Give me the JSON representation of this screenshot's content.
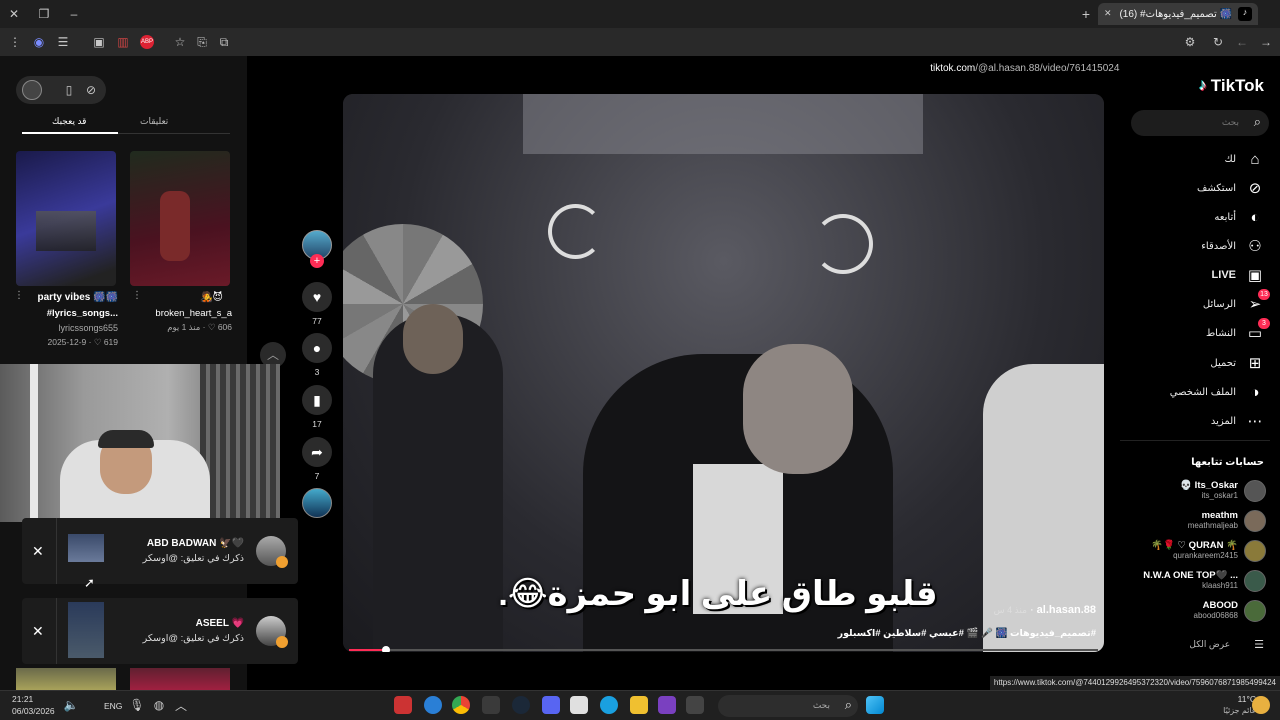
{
  "browser": {
    "tab_title": "(16) #تصميم_فيديوهات 🎆",
    "url_domain": "tiktok.com",
    "url_path": "/@al.hasan.88/video/7614150245340974357",
    "status_url": "https://www.tiktok.com/@7440129926495372320/video/7596076871985499424"
  },
  "tiktok": {
    "logo": "TikTok",
    "search_placeholder": "بحث",
    "nav": [
      {
        "label": "لك",
        "icon": "home-icon"
      },
      {
        "label": "استكشف",
        "icon": "compass-icon"
      },
      {
        "label": "أتابعه",
        "icon": "following-avatar-icon"
      },
      {
        "label": "الأصدقاء",
        "icon": "friends-icon"
      },
      {
        "label": "LIVE",
        "icon": "live-icon"
      },
      {
        "label": "الرسائل",
        "icon": "messages-icon",
        "badge": "13"
      },
      {
        "label": "النشاط",
        "icon": "activity-icon",
        "badge": "3"
      },
      {
        "label": "تحميل",
        "icon": "upload-icon"
      },
      {
        "label": "الملف الشخصي",
        "icon": "profile-icon"
      },
      {
        "label": "المزيد",
        "icon": "more-icon"
      }
    ],
    "following_title": "حسابات تتابعها",
    "following": [
      {
        "name": "💀 Its_Oskar",
        "handle": "its_oskar1"
      },
      {
        "name": "meathm",
        "handle": "meathmaljeab"
      },
      {
        "name": "🌴🌹 ♡ QURAN 🌴",
        "handle": "qurankareem2415"
      },
      {
        "name": "N.W.A ONE TOP🖤 ...",
        "handle": "klaash911"
      },
      {
        "name": "ABOOD",
        "handle": "abood06868"
      }
    ],
    "see_all": "عرض الكل"
  },
  "video": {
    "author": "al.hasan.88",
    "time_ago": "منذ 4 س",
    "caption": "#تصميم_فيديوهات 🎆 🎤 🎬 #عبسي #سلاطين #اكسبلور",
    "overlay_text": "قلبو طاق على ابو حمزة😂.",
    "progress_pct": 5,
    "likes": "77",
    "comments": "3",
    "saves": "17",
    "shares": "7"
  },
  "left_panel": {
    "tab_comments": "تعليقات",
    "tab_liked": "قد يعجبك",
    "cards": [
      {
        "title": "party vibes 🎆🎆",
        "subtitle": "#lyrics_songs...",
        "author": "lyricssongs655",
        "likes": "619",
        "date": "2025-12-9"
      },
      {
        "title": "broken_heart_s_a",
        "emoji": "🧑‍🎤😈",
        "likes": "606",
        "date": "منذ 1 يوم"
      }
    ]
  },
  "notifications": [
    {
      "name": "ABD BADWAN 🦅🖤",
      "text": "ذكرك في تعليق: @اوسكر"
    },
    {
      "name": "ASEEL 💗",
      "text": "ذكرك في تعليق: @اوسكر"
    }
  ],
  "taskbar": {
    "time": "21:21",
    "date": "06/03/2026",
    "lang": "ENG",
    "search_placeholder": "بحث",
    "weather_temp": "11°C",
    "weather_label": "غائم جزئيًا"
  },
  "colors": {
    "tiktok_red": "#fe2c55",
    "accent_cyan": "#25f4ee"
  }
}
